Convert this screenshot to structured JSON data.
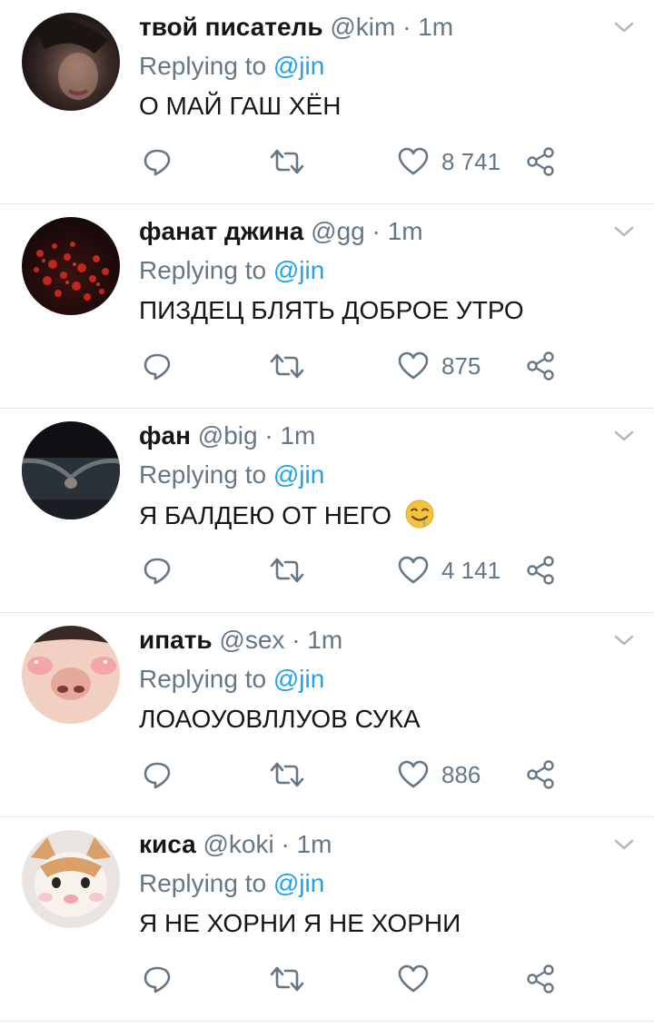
{
  "tweets": [
    {
      "name": "твой писатель",
      "handle": "@kim",
      "time": "1m",
      "reply_prefix": "Replying to",
      "reply_to": "@jin",
      "text": "О МАЙ ГАШ ХЁН",
      "likes": "8 741",
      "avatar_icon": "user-avatar"
    },
    {
      "name": "фанат джина",
      "handle": "@gg",
      "time": "1m",
      "reply_prefix": "Replying to",
      "reply_to": "@jin",
      "text": "ПИЗДЕЦ БЛЯТЬ ДОБРОЕ УТРО",
      "likes": "875",
      "avatar_icon": "red-flowers-avatar"
    },
    {
      "name": "фан",
      "handle": "@big",
      "time": "1m",
      "reply_prefix": "Replying to",
      "reply_to": "@jin",
      "text": "Я БАЛДЕЮ ОТ НЕГО",
      "emoji": "drooling-face-emoji",
      "likes": "4 141",
      "avatar_icon": "holding-hands-avatar"
    },
    {
      "name": "ипать",
      "handle": "@sex",
      "time": "1m",
      "reply_prefix": "Replying to",
      "reply_to": "@jin",
      "text": "ЛОАОУОВЛЛУОВ СУКА",
      "likes": "886",
      "avatar_icon": "face-closeup-avatar"
    },
    {
      "name": "киса",
      "handle": "@koki",
      "time": "1m",
      "reply_prefix": "Replying to",
      "reply_to": "@jin",
      "text": "Я НЕ ХОРНИ Я НЕ ХОРНИ",
      "likes": "",
      "avatar_icon": "kitten-avatar"
    }
  ],
  "colors": {
    "accent": "#1da1f2",
    "muted": "#657786",
    "text": "#14171a",
    "divider": "#e3e8ec"
  }
}
